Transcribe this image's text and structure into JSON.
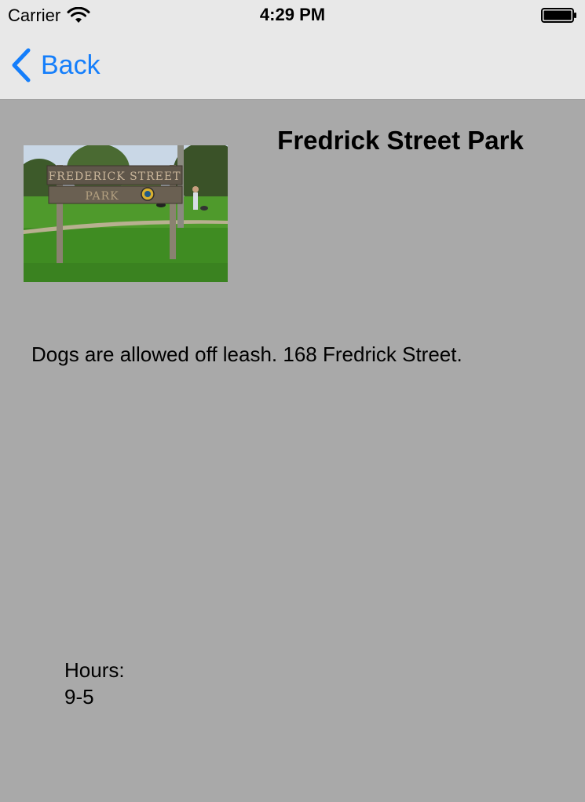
{
  "status_bar": {
    "carrier": "Carrier",
    "time": "4:29 PM"
  },
  "nav": {
    "back_label": "Back",
    "accent_color": "#147efb"
  },
  "park": {
    "title": "Fredrick Street Park",
    "photo_sign_text": "FREDERICK STREET PARK",
    "description": "Dogs are allowed off leash. 168 Fredrick Street.",
    "hours_label": "Hours:",
    "hours_value": "9-5"
  },
  "colors": {
    "background": "#a9a9a9",
    "bars": "#e8e8e8"
  }
}
